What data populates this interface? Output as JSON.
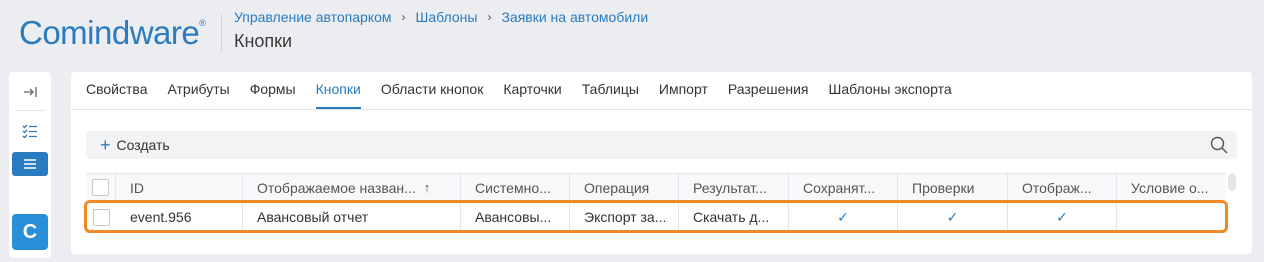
{
  "header": {
    "logo_main": "Comindware",
    "logo_tm": "®",
    "breadcrumb": [
      "Управление автопарком",
      "Шаблоны",
      "Заявки на автомобили"
    ],
    "breadcrumb_sep": "›",
    "page_title": "Кнопки"
  },
  "rail": {
    "items": [
      {
        "icon": "collapse-panel-icon",
        "glyph": "→|"
      },
      {
        "icon": "checklist-icon",
        "glyph": "☰"
      },
      {
        "icon": "list-icon",
        "glyph": "☰"
      }
    ],
    "app_letter": "C"
  },
  "tabs": [
    {
      "label": "Свойства",
      "active": false
    },
    {
      "label": "Атрибуты",
      "active": false
    },
    {
      "label": "Формы",
      "active": false
    },
    {
      "label": "Кнопки",
      "active": true
    },
    {
      "label": "Области кнопок",
      "active": false
    },
    {
      "label": "Карточки",
      "active": false
    },
    {
      "label": "Таблицы",
      "active": false
    },
    {
      "label": "Импорт",
      "active": false
    },
    {
      "label": "Разрешения",
      "active": false
    },
    {
      "label": "Шаблоны экспорта",
      "active": false
    }
  ],
  "toolbar": {
    "create_label": "Создать",
    "create_icon": "+"
  },
  "grid": {
    "columns": [
      "",
      "ID",
      "Отображаемое назван...",
      "Системно...",
      "Операция",
      "Результат...",
      "Сохранят...",
      "Проверки",
      "Отображ...",
      "Условие о..."
    ],
    "sort_arrow": "↑",
    "rows": [
      {
        "id": "event.956",
        "display_name": "Авансовый отчет",
        "system_name": "Авансовы...",
        "operation": "Экспорт за...",
        "result": "Скачать д...",
        "save": "✓",
        "checks": "✓",
        "display": "✓",
        "condition": ""
      }
    ]
  },
  "colors": {
    "accent": "#2a7bc0",
    "highlight": "#f08a24"
  }
}
